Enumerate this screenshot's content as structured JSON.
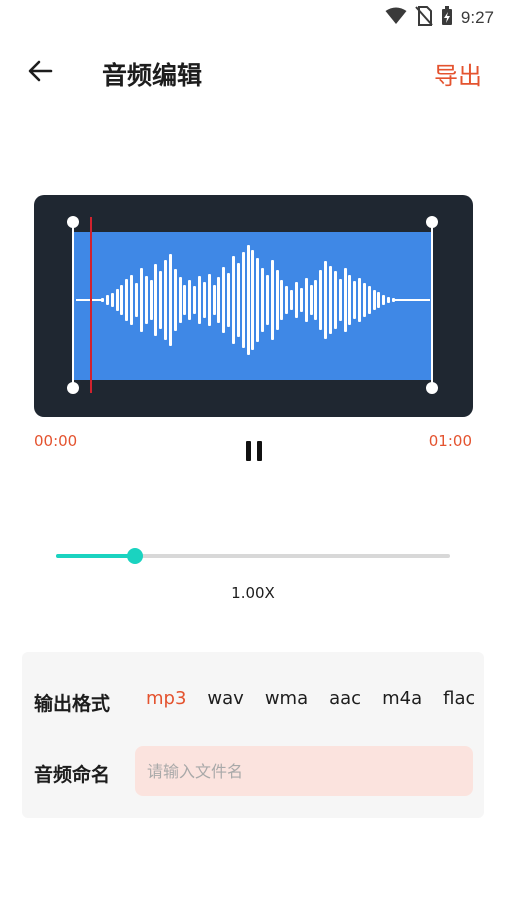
{
  "status": {
    "time": "9:27",
    "icons": [
      "wifi-icon",
      "no-sim-icon",
      "battery-charging-icon"
    ]
  },
  "appbar": {
    "back_icon": "arrow-left-icon",
    "title": "音频编辑",
    "export_label": "导出"
  },
  "waveform": {
    "selection_color": "#3f88e6",
    "background_color": "#1f2731",
    "playhead_color": "#d0222e"
  },
  "playback": {
    "start_time": "00:00",
    "end_time": "01:00",
    "state": "playing",
    "control_icon": "pause-icon"
  },
  "speed": {
    "value_label": "1.00X",
    "slider_fraction": 0.2,
    "accent_color": "#1ad3c0"
  },
  "output": {
    "format_label": "输出格式",
    "formats": [
      "mp3",
      "wav",
      "wma",
      "aac",
      "m4a",
      "flac"
    ],
    "selected_format": "mp3",
    "name_label": "音频命名",
    "name_placeholder": "请输入文件名",
    "name_value": ""
  },
  "accent_color": "#e4532f"
}
